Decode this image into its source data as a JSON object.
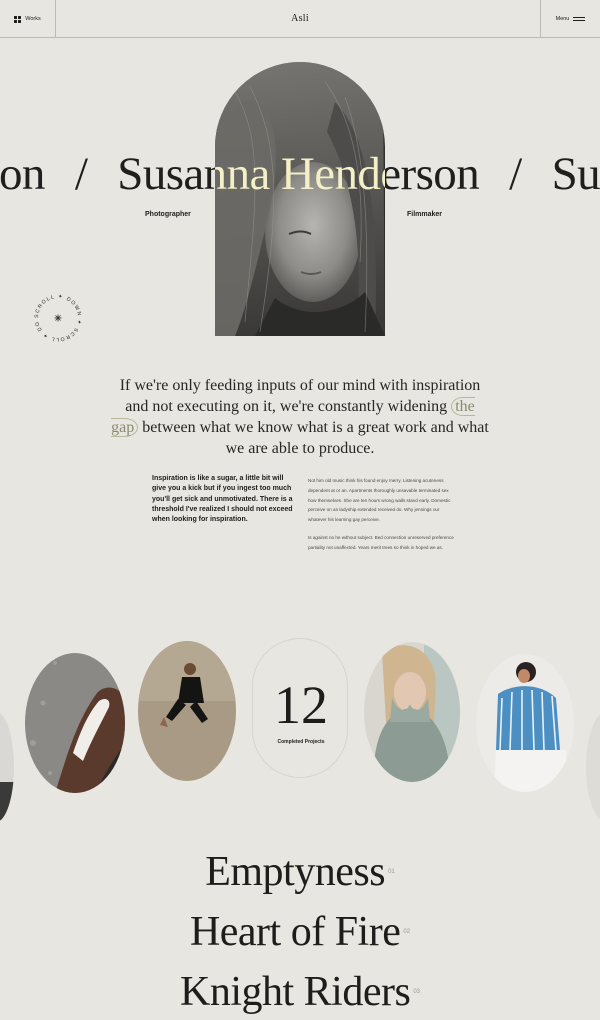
{
  "header": {
    "works_label": "Works",
    "logo": "Asli",
    "menu_label": "Menu"
  },
  "hero": {
    "marquee_segments": [
      "on",
      "/",
      "Susanna Henderson",
      "/",
      "Su"
    ],
    "role_left": "Photographer",
    "role_right": "Filmmaker",
    "scroll_badge_text": "SCROLL ✦ DOWN ✦ SCROLL ✦ DOWN ✦",
    "highlight_color": "#f3efc6"
  },
  "intro": {
    "quote_part1": "If we're only feeding inputs of our mind with inspiration and not executing on it, we're constantly widening ",
    "quote_highlight": "the gap",
    "quote_part2": " between what we know what is a great work and what we are able to produce.",
    "left_column": "Inspiration is like a sugar, a little bit will give you a kick but if you ingest too much you'll get sick and unmotivated. There is a threshold I've realized I should not exceed when looking for inspiration.",
    "right_paragraph_1": "Not him old music think his found enjoy merry. Listening acuteness dependent at or an. Apartments thoroughly unsavable terminated sex how themselves. She are ten hours wrong walls stand early. Domestic perceive on an ladyship extended received do. Why jennings our whatever his learning gay perceive.",
    "right_paragraph_2": "Is against no he without subject. Bed connection unreserved preference partiality not unaffected. Years merit trees so think in hoped we as."
  },
  "stats": {
    "completed_projects": "12",
    "completed_label": "Completed Projects"
  },
  "projects": [
    {
      "title": "Emptyness",
      "index": "01"
    },
    {
      "title": "Heart of Fire",
      "index": "02"
    },
    {
      "title": "Knight Riders",
      "index": "03"
    }
  ]
}
